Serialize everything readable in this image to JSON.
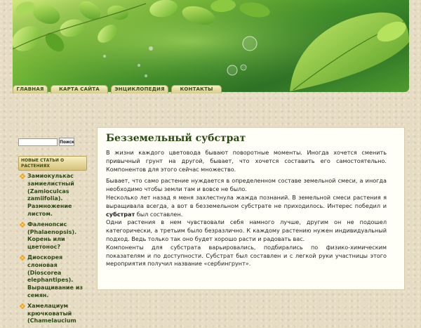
{
  "nav": {
    "items": [
      "ГЛАВНАЯ",
      "КАРТА САЙТА",
      "ЭНЦИКЛОПЕДИЯ",
      "КОНТАКТЫ"
    ]
  },
  "sidebar": {
    "search_placeholder": "",
    "search_button": "Поиск",
    "heading": "НОВЫЕ СТАТЬИ О РАСТЕНИЯХ",
    "items": [
      "Замиокулькас замиелистный (Zamioculcas zamiifolia). Размножение листом.",
      "Фаленопсис (Phalaenopsis). Корень или цветонос?",
      "Диоскорея слоновая (Dioscorea elephantipes). Выращивание из семян.",
      "Хамелациум крючковатый (Chamelaucium"
    ]
  },
  "article": {
    "title": "Безземельный субстрат",
    "p1": "В жизни каждого цветовода бывают поворотные моменты. Иногда хочется сменить привычный грунт на другой, бывает, что хочется составить его самостоятельно. Компонентов для этого сейчас множество.",
    "p2_line1": "Бывает, что само растение нуждается в определенном составе земельной смеси, а иногда необходимо чтобы земли там и вовсе не было.",
    "p2_line2": "Несколько лет назад я меня захлестнула жажда познаний. В земельной смеси растения я выращивала всегда, а вот в безземельном субстрате не приходилось. Интерес победил и",
    "p2_bold": "субстрат",
    "p2_after_bold": " был составлен.",
    "p2_line3": "Одни растения в нем чувствовали себя намного лучше, другим он не подошел категорически, а третьим было безразлично. К каждому растению нужен индивидуальный подход. Ведь только так оно будет хорошо расти и радовать вас.",
    "p2_line4": "Компоненты для субстрата варьировались, подбирались по физико-химическим показателям и по доступности. Субстрат был составлен и с легкой руки участницы этого мероприятия получил название «сербингрунт»."
  },
  "colors": {
    "title_green": "#2b4a14",
    "nav_text": "#3c4d16",
    "background": "#e6dcc4"
  }
}
